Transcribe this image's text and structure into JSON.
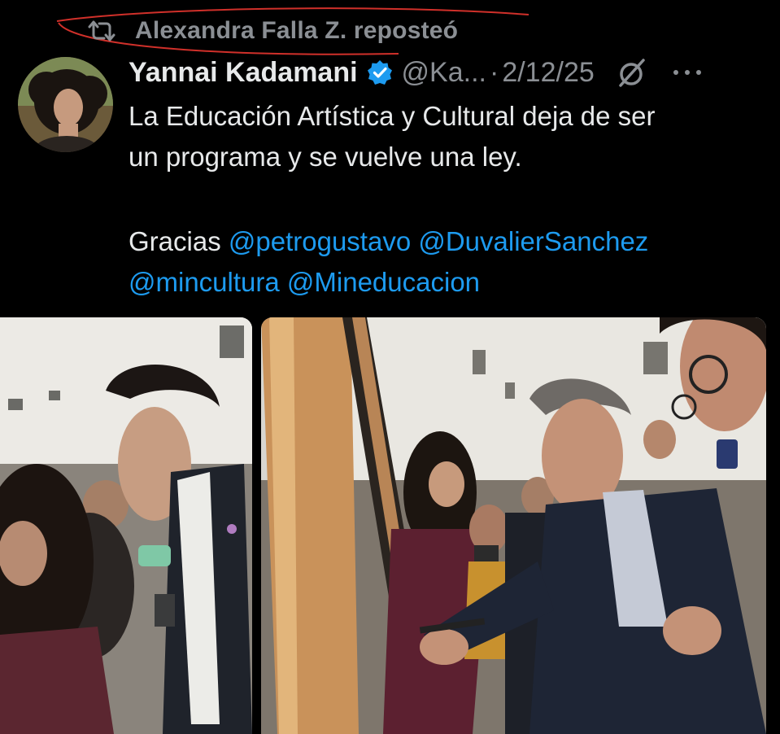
{
  "repost": {
    "icon": "repost-icon",
    "text": "Alexandra Falla Z. reposteó"
  },
  "tweet": {
    "author_name": "Yannai Kadamani",
    "handle": "@Ka...",
    "separator": "·",
    "date": "2/12/25",
    "verified_color": "#1d9bf0",
    "text_line1": "La Educación Artística y Cultural deja de ser",
    "text_line2": "un programa y se vuelve una ley.",
    "gracias": "Gracias",
    "mentions": [
      "@petrogustavo",
      "@DuvalierSanchez",
      "@mincultura",
      "@Mineducacion"
    ]
  },
  "colors": {
    "background": "#000000",
    "text": "#e7e9ea",
    "secondary": "#8b8f94",
    "accent": "#1d9bf0",
    "annotation": "#d0302a"
  }
}
